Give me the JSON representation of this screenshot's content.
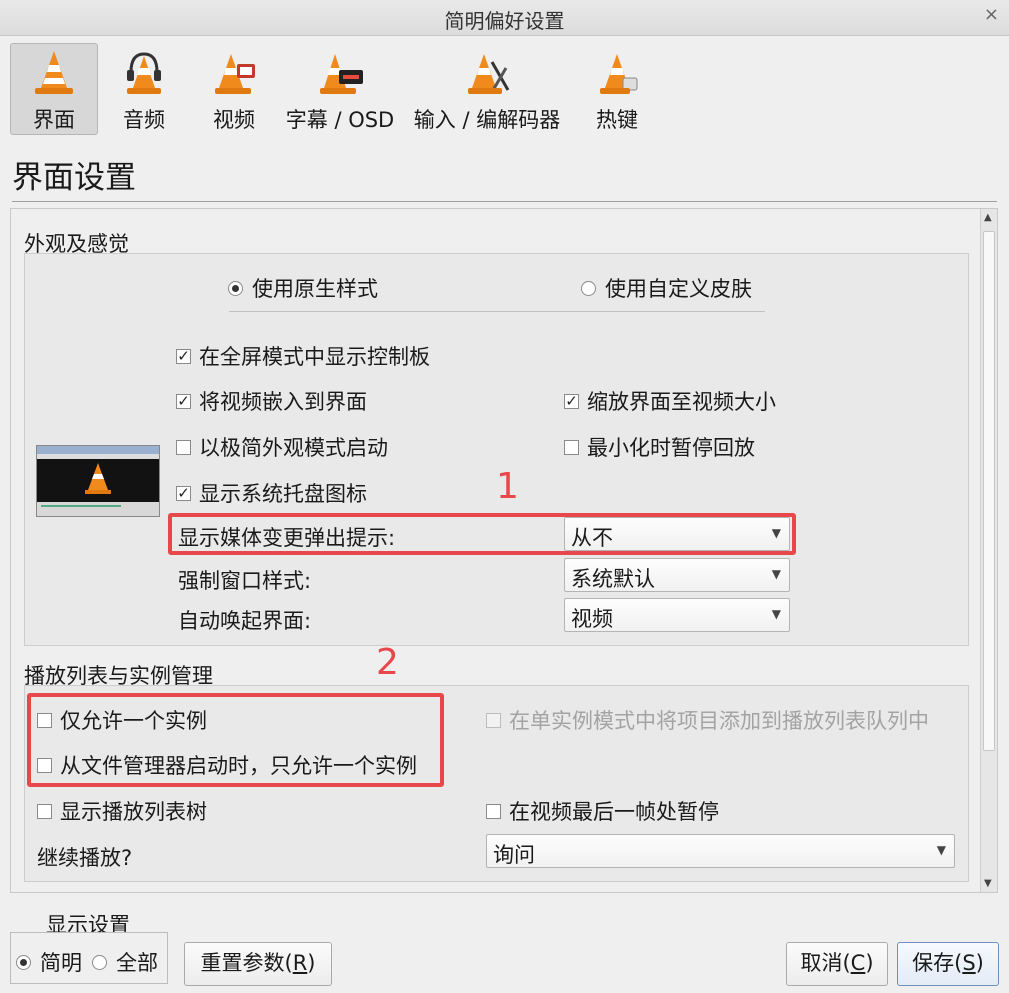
{
  "window": {
    "title": "简明偏好设置",
    "close_glyph": "×"
  },
  "toolbar": [
    {
      "label": "界面",
      "icon": "interface-cone-icon",
      "active": true
    },
    {
      "label": "音频",
      "icon": "audio-headphones-cone-icon",
      "active": false
    },
    {
      "label": "视频",
      "icon": "video-cone-icon",
      "active": false
    },
    {
      "label": "字幕 / OSD",
      "icon": "subtitles-osd-cone-icon",
      "active": false
    },
    {
      "label": "输入 / 编解码器",
      "icon": "input-codecs-cone-icon",
      "active": false
    },
    {
      "label": "热键",
      "icon": "hotkeys-cone-icon",
      "active": false
    }
  ],
  "page_title": "界面设置",
  "look_feel": {
    "title": "外观及感觉",
    "radio_native": "使用原生样式",
    "radio_custom": "使用自定义皮肤",
    "cb_fullscreen_controls": "在全屏模式中显示控制板",
    "cb_embed_video": "将视频嵌入到界面",
    "cb_resize_to_video": "缩放界面至视频大小",
    "cb_minimal_mode": "以极简外观模式启动",
    "cb_pause_minimized": "最小化时暂停回放",
    "cb_systray": "显示系统托盘图标",
    "popup_label": "显示媒体变更弹出提示:",
    "popup_value": "从不",
    "force_style_label": "强制窗口样式:",
    "force_style_value": "系统默认",
    "raise_label": "自动唤起界面:",
    "raise_value": "视频"
  },
  "playlist": {
    "title": "播放列表与实例管理",
    "cb_one_instance": "仅允许一个实例",
    "cb_enqueue_single": "在单实例模式中将项目添加到播放列表队列中",
    "cb_one_instance_fm": "从文件管理器启动时，只允许一个实例",
    "cb_tree": "显示播放列表树",
    "cb_pause_last": "在视频最后一帧处暂停",
    "continue_label": "继续播放?",
    "continue_value": "询问"
  },
  "annotations": {
    "n1": "1",
    "n2": "2"
  },
  "bottom": {
    "show_settings": "显示设置",
    "simple": "简明",
    "all": "全部",
    "reset_text": "重置参数(",
    "reset_key": "R",
    "cancel_text": "取消(",
    "cancel_key": "C",
    "save_text": "保存(",
    "save_key": "S",
    "close_paren": ")"
  },
  "check_glyph": "✓",
  "colors": {
    "annotation_red": "#e8484b",
    "cone_orange": "#f08a1c"
  }
}
